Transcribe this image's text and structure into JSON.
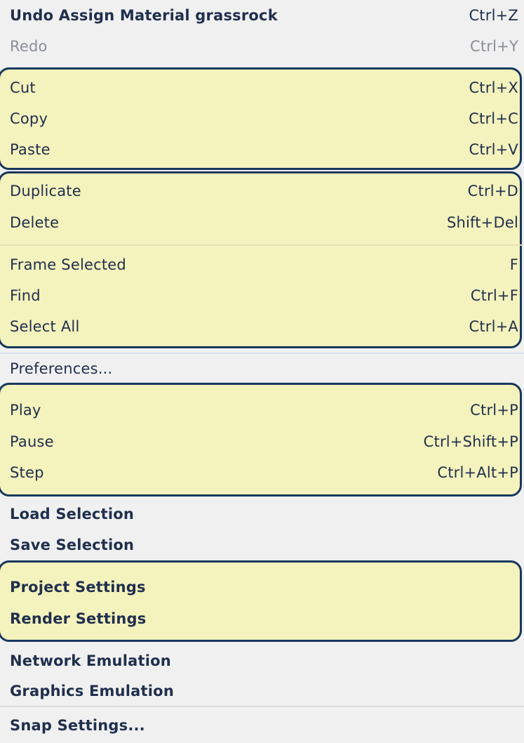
{
  "menu": {
    "undo": {
      "label": "Undo Assign Material grassrock",
      "shortcut": "Ctrl+Z"
    },
    "redo": {
      "label": "Redo",
      "shortcut": "Ctrl+Y"
    },
    "cut": {
      "label": "Cut",
      "shortcut": "Ctrl+X"
    },
    "copy": {
      "label": "Copy",
      "shortcut": "Ctrl+C"
    },
    "paste": {
      "label": "Paste",
      "shortcut": "Ctrl+V"
    },
    "duplicate": {
      "label": "Duplicate",
      "shortcut": "Ctrl+D"
    },
    "delete": {
      "label": "Delete",
      "shortcut": "Shift+Del"
    },
    "frame_selected": {
      "label": "Frame Selected",
      "shortcut": "F"
    },
    "find": {
      "label": "Find",
      "shortcut": "Ctrl+F"
    },
    "select_all": {
      "label": "Select All",
      "shortcut": "Ctrl+A"
    },
    "preferences": {
      "label": "Preferences..."
    },
    "play": {
      "label": "Play",
      "shortcut": "Ctrl+P"
    },
    "pause": {
      "label": "Pause",
      "shortcut": "Ctrl+Shift+P"
    },
    "step": {
      "label": "Step",
      "shortcut": "Ctrl+Alt+P"
    },
    "load_selection": {
      "label": "Load Selection"
    },
    "save_selection": {
      "label": "Save Selection"
    },
    "project_settings": {
      "label": "Project Settings"
    },
    "render_settings": {
      "label": "Render Settings"
    },
    "network_emulation": {
      "label": "Network Emulation"
    },
    "graphics_emulation": {
      "label": "Graphics Emulation"
    },
    "snap_settings": {
      "label": "Snap Settings..."
    }
  },
  "colors": {
    "highlight_fill": "#f4f2bd",
    "highlight_border": "#17385d",
    "menu_background": "#f0f0f0",
    "text": "#1f2f4d",
    "disabled_text": "#8a8f96"
  }
}
